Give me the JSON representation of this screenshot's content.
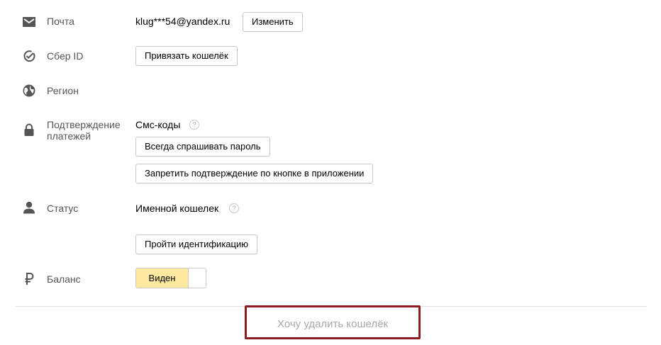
{
  "rows": {
    "email": {
      "label": "Почта",
      "value": "klug***54@yandex.ru",
      "button": "Изменить"
    },
    "sber_id": {
      "label": "Сбер ID",
      "button": "Привязать кошелёк"
    },
    "region": {
      "label": "Регион"
    },
    "payment_confirmation": {
      "label_line1": "Подтверждение",
      "label_line2": "платежей",
      "value": "Смс-коды",
      "help": "?",
      "button_always_ask": "Всегда спрашивать пароль",
      "button_forbid": "Запретить подтверждение по кнопке в приложении"
    },
    "status": {
      "label": "Статус",
      "value": "Именной кошелек",
      "help": "?",
      "button": "Пройти идентификацию"
    },
    "balance": {
      "label": "Баланс",
      "toggle_label": "Виден",
      "toggle_state": "on"
    }
  },
  "delete_link": "Хочу удалить кошелёк",
  "colors": {
    "toggle_active": "#fde9a0",
    "highlight_border": "#8a1c22",
    "label_text": "#555555",
    "icon": "#555555"
  },
  "icons": [
    "mail-icon",
    "sber-check-icon",
    "globe-icon",
    "lock-icon",
    "person-icon",
    "ruble-icon"
  ]
}
